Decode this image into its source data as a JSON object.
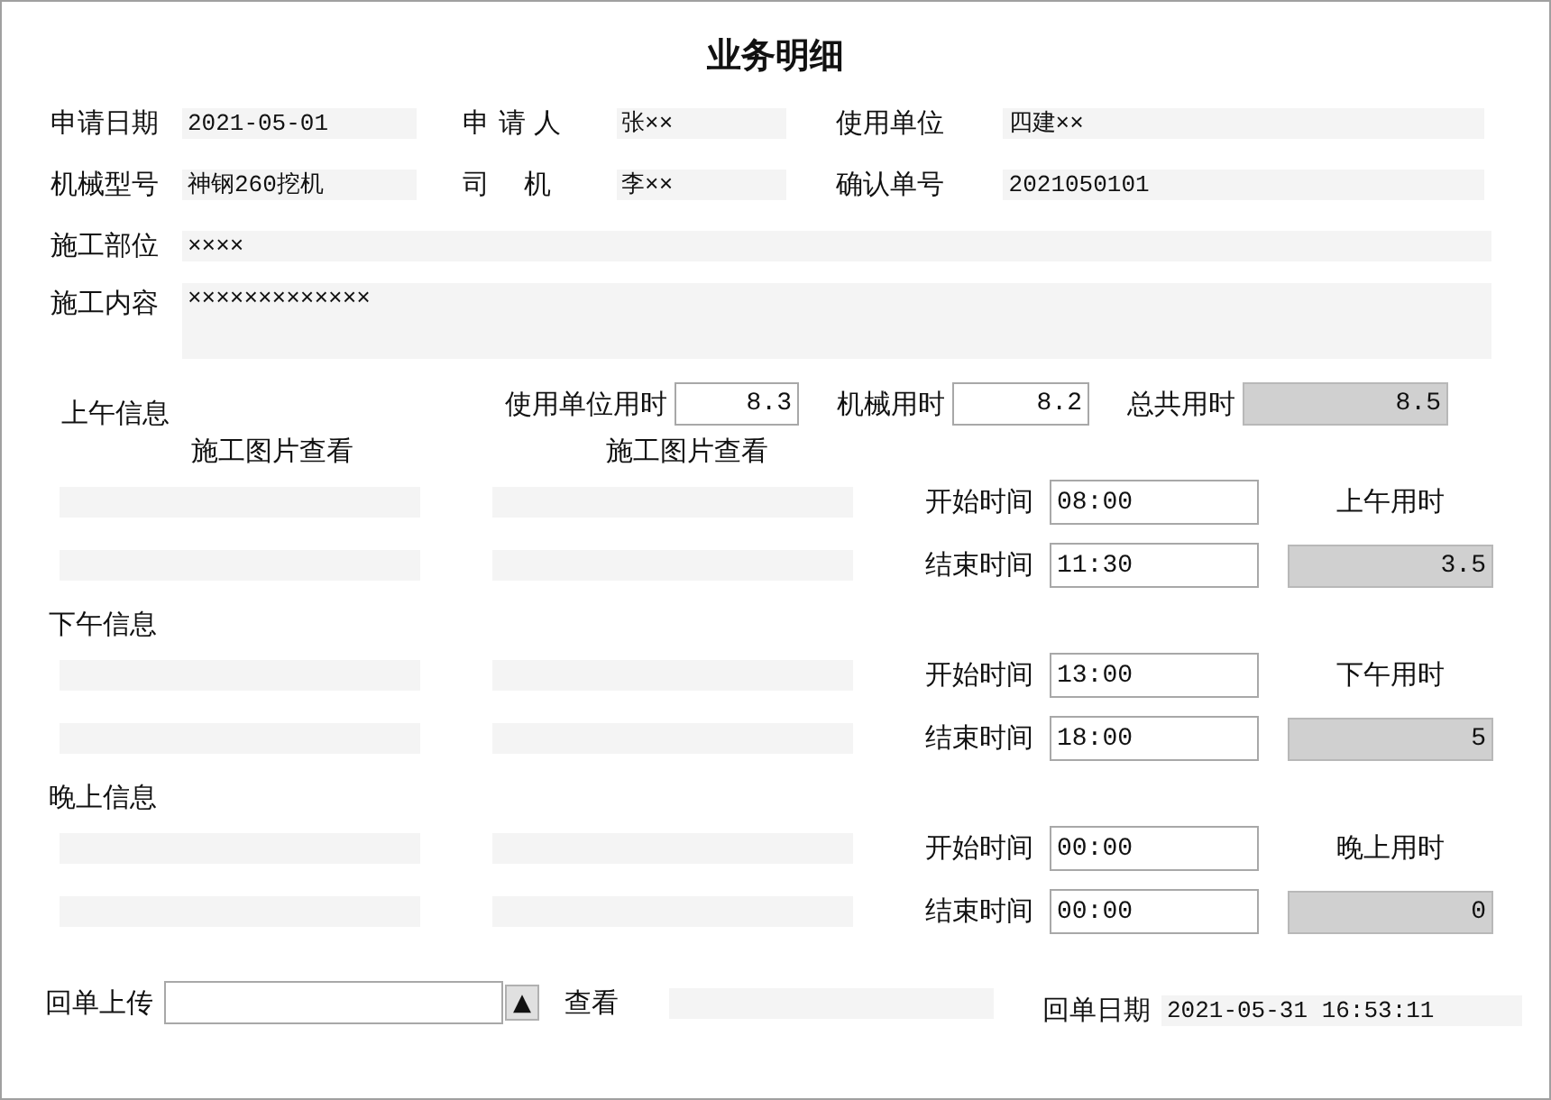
{
  "title": "业务明细",
  "field_rows": [
    [
      {
        "label": "申请日期",
        "value": "2021-05-01"
      },
      {
        "label": "申 请 人",
        "value": "张××"
      },
      {
        "label": "使用单位",
        "value": "四建××"
      }
    ],
    [
      {
        "label": "机械型号",
        "value": "神钢260挖机"
      },
      {
        "label": "司    机",
        "value": "李××"
      },
      {
        "label": "确认单号",
        "value": "2021050101"
      }
    ]
  ],
  "site": {
    "label": "施工部位",
    "value": "××××"
  },
  "content": {
    "label": "施工内容",
    "value": "×××××××××××××"
  },
  "hours": [
    {
      "label": "使用单位用时",
      "value": "8.3",
      "readonly": false
    },
    {
      "label": "机械用时",
      "value": "8.2",
      "readonly": false
    },
    {
      "label": "总共用时",
      "value": "8.5",
      "readonly": true
    }
  ],
  "photo_headers": [
    "施工图片查看",
    "施工图片查看"
  ],
  "sections": [
    {
      "title": "上午信息",
      "start": {
        "label": "开始时间",
        "value": "08:00"
      },
      "end": {
        "label": "结束时间",
        "value": "11:30"
      },
      "total_label": "上午用时",
      "total_value": "3.5"
    },
    {
      "title": "下午信息",
      "start": {
        "label": "开始时间",
        "value": "13:00"
      },
      "end": {
        "label": "结束时间",
        "value": "18:00"
      },
      "total_label": "下午用时",
      "total_value": "5"
    },
    {
      "title": "晚上信息",
      "start": {
        "label": "开始时间",
        "value": "00:00"
      },
      "end": {
        "label": "结束时间",
        "value": "00:00"
      },
      "total_label": "晚上用时",
      "total_value": "0"
    }
  ],
  "footer": {
    "upload_label": "回单上传",
    "upload_button": "▲",
    "view_label": "查看",
    "date_label": "回单日期",
    "date_value": "2021-05-31 16:53:11"
  }
}
